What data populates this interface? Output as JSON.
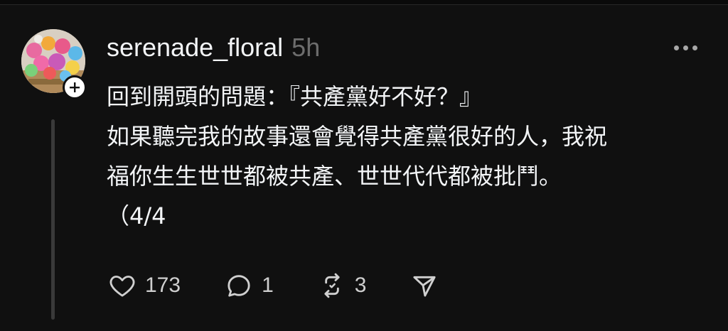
{
  "post": {
    "username": "serenade_floral",
    "timestamp": "5h",
    "lines": [
      "回到開頭的問題：『共產黨好不好？』",
      "如果聽完我的故事還會覺得共產黨很好的人，我祝",
      "福你生生世世都被共產、世世代代都被批鬥。",
      "（4/4"
    ]
  },
  "actions": {
    "like": {
      "icon": "heart-icon",
      "count": "173"
    },
    "reply": {
      "icon": "comment-icon",
      "count": "1"
    },
    "repost": {
      "icon": "repost-icon",
      "count": "3"
    },
    "share": {
      "icon": "send-icon"
    }
  },
  "colors": {
    "background": "#101010",
    "text": "#f3f5f7",
    "secondary_text": "#6d6d6d",
    "thread_line": "#3a3a3a"
  }
}
